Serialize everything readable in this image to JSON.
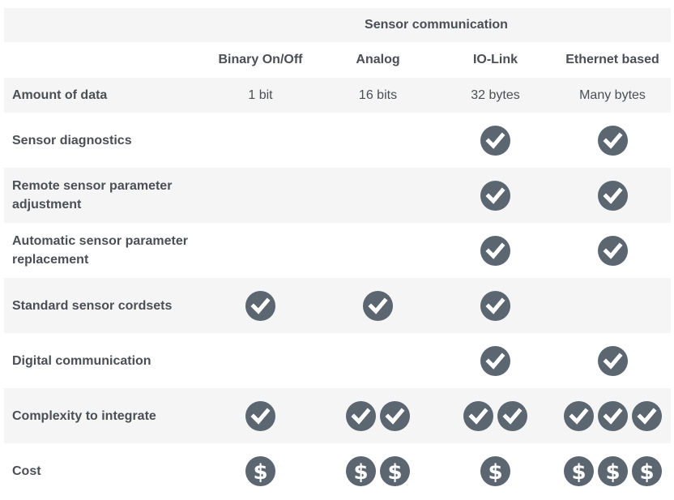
{
  "title": "Sensor communication",
  "columns": [
    "Binary On/Off",
    "Analog",
    "IO-Link",
    "Ethernet based"
  ],
  "amount_of_data": {
    "label": "Amount of data",
    "values": [
      "1 bit",
      "16 bits",
      "32 bytes",
      "Many bytes"
    ]
  },
  "feature_rows": [
    {
      "label": "Sensor diagnostics",
      "icon": "check-icon",
      "counts": [
        0,
        0,
        1,
        1
      ]
    },
    {
      "label": "Remote sensor parameter adjustment",
      "icon": "check-icon",
      "counts": [
        0,
        0,
        1,
        1
      ]
    },
    {
      "label": "Automatic sensor parameter replacement",
      "icon": "check-icon",
      "counts": [
        0,
        0,
        1,
        1
      ]
    },
    {
      "label": "Standard sensor cordsets",
      "icon": "check-icon",
      "counts": [
        1,
        1,
        1,
        0
      ]
    },
    {
      "label": "Digital communication",
      "icon": "check-icon",
      "counts": [
        0,
        0,
        1,
        1
      ]
    },
    {
      "label": "Complexity to integrate",
      "icon": "check-icon",
      "counts": [
        1,
        2,
        2,
        3
      ]
    },
    {
      "label": "Cost",
      "icon": "dollar-icon",
      "counts": [
        1,
        2,
        1,
        3
      ]
    }
  ],
  "colors": {
    "icon": "#5c6670",
    "band": "#f5f5f5",
    "text": "#4a4f55"
  }
}
